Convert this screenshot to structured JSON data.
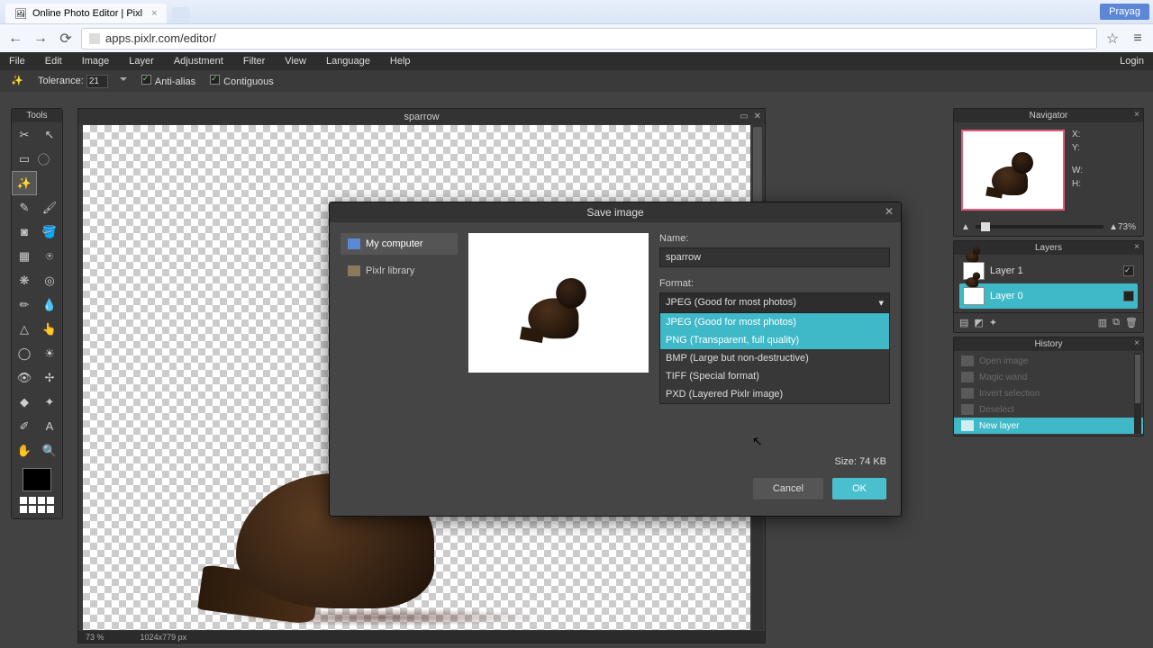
{
  "browser": {
    "tab_title": "Online Photo Editor | Pixl",
    "url": "apps.pixlr.com/editor/",
    "profile": "Prayag"
  },
  "menu": {
    "file": "File",
    "edit": "Edit",
    "image": "Image",
    "layer": "Layer",
    "adjustment": "Adjustment",
    "filter": "Filter",
    "view": "View",
    "language": "Language",
    "help": "Help",
    "login": "Login"
  },
  "options": {
    "tolerance_label": "Tolerance:",
    "tolerance_value": "21",
    "antialias": "Anti-alias",
    "contiguous": "Contiguous"
  },
  "tools_title": "Tools",
  "document": {
    "title": "sparrow",
    "zoom": "73",
    "zoom_unit": "%",
    "dims": "1024x779 px"
  },
  "navigator": {
    "title": "Navigator",
    "x_label": "X:",
    "y_label": "Y:",
    "w_label": "W:",
    "h_label": "H:",
    "zoom_pct": "73",
    "pct_sign": "%"
  },
  "layers": {
    "title": "Layers",
    "items": [
      {
        "name": "Layer 1",
        "visible": true
      },
      {
        "name": "Layer 0",
        "visible": false
      }
    ]
  },
  "history": {
    "title": "History",
    "items": [
      {
        "label": "Open image"
      },
      {
        "label": "Magic wand"
      },
      {
        "label": "Invert selection"
      },
      {
        "label": "Deselect"
      },
      {
        "label": "New layer"
      }
    ],
    "selected_index": 4
  },
  "dialog": {
    "title": "Save image",
    "dest_computer": "My computer",
    "dest_library": "Pixlr library",
    "name_label": "Name:",
    "name_value": "sparrow",
    "format_label": "Format:",
    "format_current": "JPEG (Good for most photos)",
    "format_options": [
      "JPEG (Good for most photos)",
      "PNG (Transparent, full quality)",
      "BMP (Large but non-destructive)",
      "TIFF (Special format)",
      "PXD (Layered Pixlr image)"
    ],
    "size_label": "Size: 74 KB",
    "cancel": "Cancel",
    "ok": "OK"
  }
}
